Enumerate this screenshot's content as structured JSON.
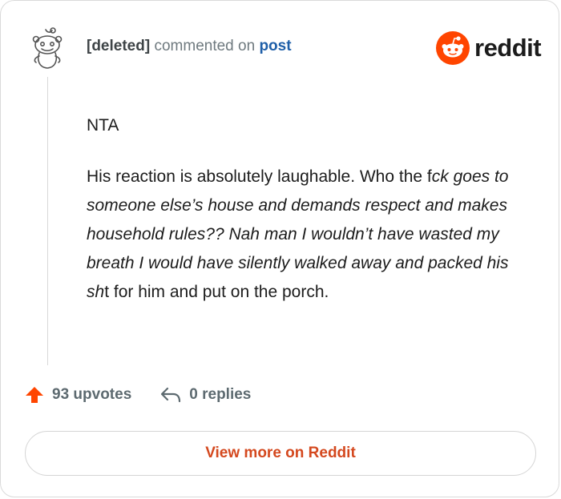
{
  "header": {
    "author": "[deleted]",
    "action": "commented on",
    "post_link": "post",
    "brand": "reddit"
  },
  "comment": {
    "line1": "NTA",
    "para_normal_1": "His reaction is absolutely laughable. Who the f",
    "para_italic_1": "ck goes to someone else’s house and demands respect and makes household rules?? Nah man I wouldn’t have wasted my breath I would have silently walked away and packed his sh",
    "para_normal_2": "t for him and put on the porch."
  },
  "footer": {
    "upvotes": "93 upvotes",
    "replies": "0 replies"
  },
  "cta": {
    "label": "View more on Reddit"
  },
  "colors": {
    "brand": "#ff4500",
    "link": "#1f5fa8",
    "cta": "#d4481e"
  },
  "icons": [
    "snoo-avatar-icon",
    "reddit-logo-icon",
    "upvote-arrow-icon",
    "reply-arrow-icon"
  ]
}
